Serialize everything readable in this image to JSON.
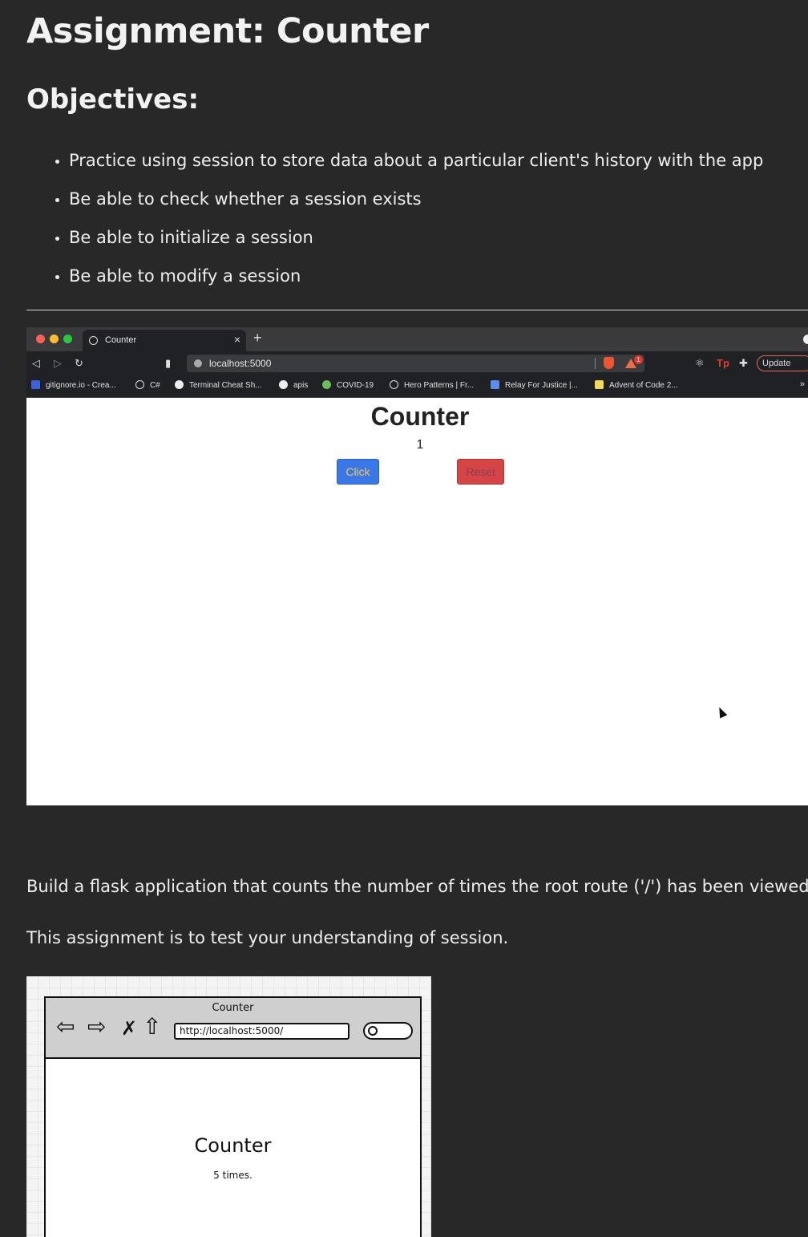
{
  "page": {
    "title": "Assignment: Counter",
    "objectives_heading": "Objectives:",
    "objectives": [
      "Practice using session to store data about a particular client's history with the app",
      "Be able to check whether a session exists",
      "Be able to initialize a session",
      "Be able to modify a session"
    ],
    "paragraphs": [
      "Build a flask application that counts the number of times the root route ('/') has been viewed.",
      "This assignment is to test your understanding of session."
    ]
  },
  "browser": {
    "tab_title": "Counter",
    "tab_close": "×",
    "new_tab": "+",
    "url": "localhost:5000",
    "rewards_badge": "1",
    "update_label": "Update",
    "bookmarks": [
      {
        "label": "gitignore.io - Crea...",
        "icon": "gitignore-icon",
        "color": "#3b63d9"
      },
      {
        "label": "C#",
        "icon": "globe-icon",
        "color": "#dddddd"
      },
      {
        "label": "Terminal Cheat Sh...",
        "icon": "github-icon",
        "color": "#eeeeee"
      },
      {
        "label": "apis",
        "icon": "github-icon",
        "color": "#eeeeee"
      },
      {
        "label": "COVID-19",
        "icon": "covid-icon",
        "color": "#6bbf59"
      },
      {
        "label": "Hero Patterns | Fr...",
        "icon": "globe-icon",
        "color": "#dddddd"
      },
      {
        "label": "Relay For Justice |...",
        "icon": "trello-icon",
        "color": "#5b8def"
      },
      {
        "label": "Advent of Code 2...",
        "icon": "star-icon",
        "color": "#f2d95a"
      }
    ],
    "bookmarks_more": "»",
    "app": {
      "heading": "Counter",
      "count": "1",
      "click_label": "Click",
      "reset_label": "Reset"
    }
  },
  "wireframe": {
    "window_title": "Counter",
    "url": "http://localhost:5000/",
    "heading": "Counter",
    "times": "5 times."
  },
  "colors": {
    "background": "#282828",
    "click_button": "#3b78e7",
    "reset_button": "#d64546"
  }
}
